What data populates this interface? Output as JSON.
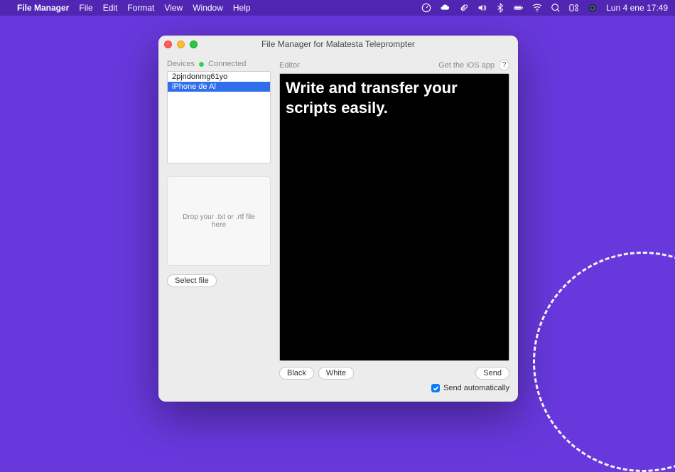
{
  "menubar": {
    "app": "File Manager",
    "items": [
      "File",
      "Edit",
      "Format",
      "View",
      "Window",
      "Help"
    ],
    "clock": "Lun 4 ene  17:49"
  },
  "window": {
    "title": "File Manager for Malatesta Teleprompter"
  },
  "sidebar": {
    "header": "Devices",
    "status": "Connected",
    "devices": [
      {
        "name": "2pjndonmg61yo",
        "selected": false
      },
      {
        "name": "iPhone de Al",
        "selected": true
      }
    ],
    "dropzone": "Drop your .txt or .rtf file here",
    "select_file": "Select file"
  },
  "editor": {
    "header": "Editor",
    "get_app": "Get the iOS app",
    "help": "?",
    "content": "Write and transfer your scripts easily.",
    "black": "Black",
    "white": "White",
    "send": "Send",
    "auto": "Send automatically"
  }
}
